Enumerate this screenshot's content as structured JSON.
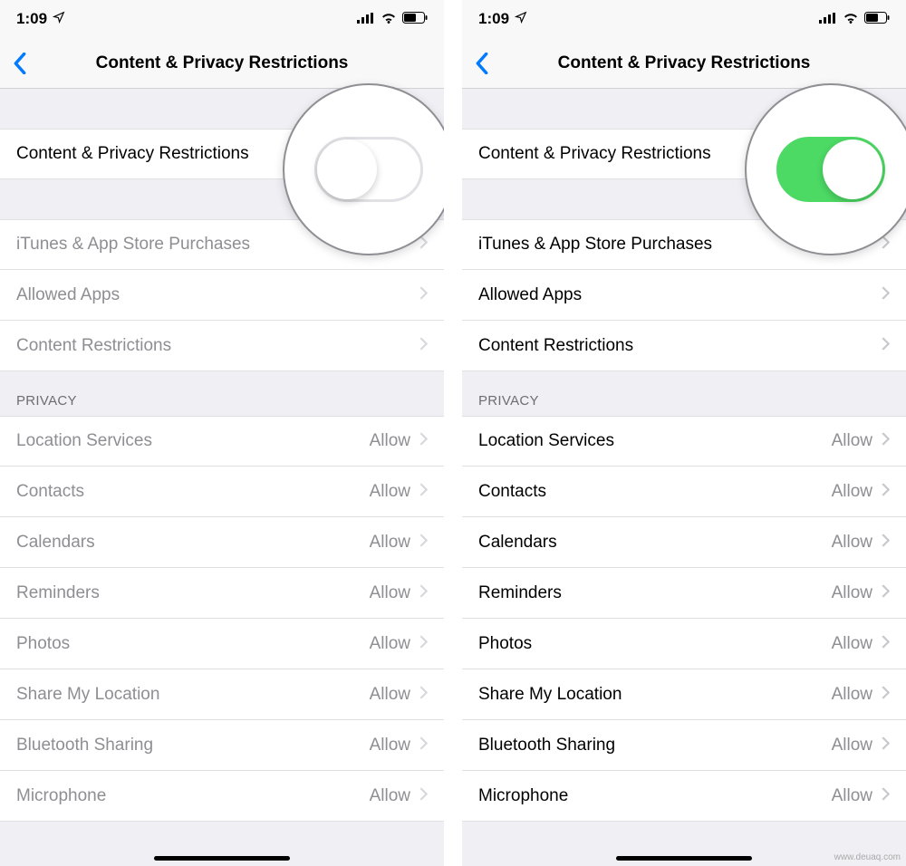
{
  "status": {
    "time": "1:09"
  },
  "nav": {
    "title": "Content & Privacy Restrictions"
  },
  "main_toggle": {
    "label": "Content & Privacy Restrictions"
  },
  "store_group": [
    {
      "label": "iTunes & App Store Purchases"
    },
    {
      "label": "Allowed Apps"
    },
    {
      "label": "Content Restrictions"
    }
  ],
  "privacy_header": "PRIVACY",
  "privacy_items": [
    {
      "label": "Location Services",
      "value": "Allow"
    },
    {
      "label": "Contacts",
      "value": "Allow"
    },
    {
      "label": "Calendars",
      "value": "Allow"
    },
    {
      "label": "Reminders",
      "value": "Allow"
    },
    {
      "label": "Photos",
      "value": "Allow"
    },
    {
      "label": "Share My Location",
      "value": "Allow"
    },
    {
      "label": "Bluetooth Sharing",
      "value": "Allow"
    },
    {
      "label": "Microphone",
      "value": "Allow"
    }
  ],
  "watermark": "www.deuaq.com"
}
